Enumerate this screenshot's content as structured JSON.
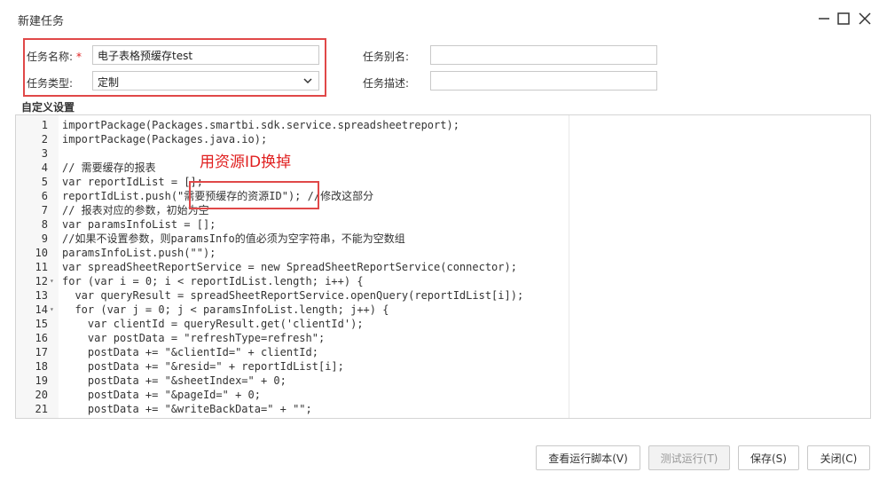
{
  "window": {
    "title": "新建任务"
  },
  "form": {
    "task_name_label": "任务名称:",
    "required_mark": "*",
    "task_name_value": "电子表格预缓存test",
    "task_type_label": "任务类型:",
    "task_type_value": "定制",
    "task_alias_label": "任务别名:",
    "task_alias_value": "",
    "task_desc_label": "任务描述:",
    "task_desc_value": ""
  },
  "custom_settings_label": "自定义设置",
  "editor": {
    "lines": [
      {
        "n": "1",
        "code": "importPackage(Packages.smartbi.sdk.service.spreadsheetreport);"
      },
      {
        "n": "2",
        "code": "importPackage(Packages.java.io);"
      },
      {
        "n": "3",
        "code": ""
      },
      {
        "n": "4",
        "code": "// 需要缓存的报表"
      },
      {
        "n": "5",
        "code": "var reportIdList = [];"
      },
      {
        "n": "6",
        "code": "reportIdList.push(\"需要预缓存的资源ID\"); //修改这部分"
      },
      {
        "n": "7",
        "code": "// 报表对应的参数，初始为空"
      },
      {
        "n": "8",
        "code": "var paramsInfoList = [];"
      },
      {
        "n": "9",
        "code": "//如果不设置参数，则paramsInfo的值必须为空字符串，不能为空数组"
      },
      {
        "n": "10",
        "code": "paramsInfoList.push(\"\");"
      },
      {
        "n": "11",
        "code": "var spreadSheetReportService = new SpreadSheetReportService(connector);"
      },
      {
        "n": "12",
        "code": "for (var i = 0; i < reportIdList.length; i++) {"
      },
      {
        "n": "13",
        "code": "  var queryResult = spreadSheetReportService.openQuery(reportIdList[i]);"
      },
      {
        "n": "14",
        "code": "  for (var j = 0; j < paramsInfoList.length; j++) {"
      },
      {
        "n": "15",
        "code": "    var clientId = queryResult.get('clientId');"
      },
      {
        "n": "16",
        "code": "    var postData = \"refreshType=refresh\";"
      },
      {
        "n": "17",
        "code": "    postData += \"&clientId=\" + clientId;"
      },
      {
        "n": "18",
        "code": "    postData += \"&resid=\" + reportIdList[i];"
      },
      {
        "n": "19",
        "code": "    postData += \"&sheetIndex=\" + 0;"
      },
      {
        "n": "20",
        "code": "    postData += \"&pageId=\" + 0;"
      },
      {
        "n": "21",
        "code": "    postData += \"&writeBackData=\" + \"\";"
      }
    ]
  },
  "annotation": "用资源ID换掉",
  "buttons": {
    "view_script": "查看运行脚本(V)",
    "test_run": "测试运行(T)",
    "save": "保存(S)",
    "close": "关闭(C)"
  },
  "colors": {
    "annotation_red": "#e02020",
    "highlight_box": "#e04848"
  }
}
